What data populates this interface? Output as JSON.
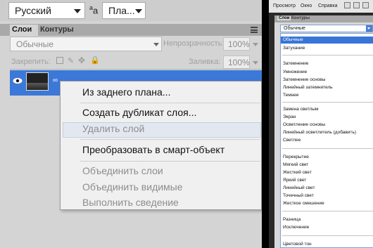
{
  "toolbar": {
    "language_value": "Русский",
    "aa_label": "a",
    "aa_sup": "a",
    "antialias_value": "Пла..."
  },
  "layers_panel": {
    "tabs": [
      "Слои",
      "Контуры"
    ],
    "blend_mode_value": "Обычные",
    "opacity_label": "Непрозрачность:",
    "opacity_value": "100%",
    "lock_label": "Закрепить:",
    "fill_label": "Заливка:",
    "fill_value": "100%"
  },
  "context_menu": {
    "items": [
      {
        "label": "Из заднего плана...",
        "enabled": true
      },
      {
        "label": "Создать дубликат слоя...",
        "enabled": true,
        "hovered": true
      },
      {
        "label": "Удалить слой",
        "enabled": false
      },
      {
        "label": "Преобразовать в смарт-объект",
        "enabled": true
      },
      {
        "label": "Объединить слои",
        "enabled": false
      },
      {
        "label": "Объединить видимые",
        "enabled": false
      },
      {
        "label": "Выполнить сведение",
        "enabled": false
      }
    ]
  },
  "right_window": {
    "menu": [
      "Просмотр",
      "Окно",
      "Справка"
    ],
    "tabs": [
      "Слои",
      "Контуры"
    ],
    "blend_select_value": "Обычные",
    "blend_modes": [
      "Обычные",
      "Затухание",
      "Затемнение",
      "Умножение",
      "Затемнение основы",
      "Линейный затемнитель",
      "Темнее",
      "Замена светлым",
      "Экран",
      "Осветление основы",
      "Линейный осветлитель (добавить)",
      "Светлее",
      "Перекрытие",
      "Мягкий свет",
      "Жесткий свет",
      "Яркий свет",
      "Линейный свет",
      "Точечный свет",
      "Жесткое смешение",
      "Разница",
      "Исключение",
      "Цветовой тон"
    ]
  },
  "colors": {
    "selection_blue": "#3c78d8",
    "list_selection": "#3875d7",
    "panel_grey": "#d4d4d4"
  }
}
